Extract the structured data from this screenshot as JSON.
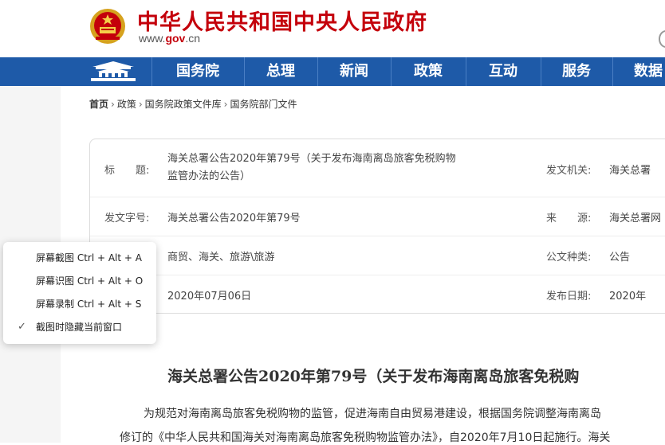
{
  "header": {
    "site_title": "中华人民共和国中央人民政府",
    "url_prefix": "www.",
    "url_gov": "gov",
    "url_suffix": ".cn"
  },
  "nav": {
    "items": [
      "国务院",
      "总理",
      "新闻",
      "政策",
      "互动",
      "服务",
      "数据"
    ]
  },
  "breadcrumb": [
    "首页",
    "政策",
    "国务院政策文件库",
    "国务院部门文件"
  ],
  "breadcrumb_sep": "›",
  "info": {
    "title_label": "标　　题:",
    "title_value": "海关总署公告2020年第79号（关于发布海南离岛旅客免税购物监管办法的公告）",
    "issuer_label": "发文机关:",
    "issuer_value": "海关总署",
    "docno_label": "发文字号:",
    "docno_value": "海关总署公告2020年第79号",
    "source_label": "来　　源:",
    "source_value": "海关总署网",
    "topic_value": "商贸、海关、旅游\\旅游",
    "doctype_label": "公文种类:",
    "doctype_value": "公告",
    "date_value": "2020年07月06日",
    "pubdate_label": "发布日期:",
    "pubdate_value": "2020年"
  },
  "article": {
    "title": "海关总署公告2020年第79号（关于发布海南离岛旅客免税购",
    "line1": "为规范对海南离岛旅客免税购物的监管，促进海南自由贸易港建设，根据国务院调整海南离岛",
    "line2": "修订的《中华人民共和国海关对海南离岛旅客免税购物监管办法》，自2020年7月10日起施行。海关"
  },
  "context_menu": {
    "items": [
      {
        "label": "屏幕截图 Ctrl + Alt + A",
        "checked": false
      },
      {
        "label": "屏幕识图 Ctrl + Alt + O",
        "checked": false
      },
      {
        "label": "屏幕录制 Ctrl + Alt + S",
        "checked": false
      },
      {
        "label": "截图时隐藏当前窗口",
        "checked": true
      }
    ],
    "check_glyph": "✓"
  },
  "colors": {
    "brand_red": "#c4000b",
    "nav_blue": "#1e5aa8"
  },
  "icons": [
    "national-emblem-icon",
    "tiananmen-gate-icon",
    "checkmark-icon"
  ]
}
